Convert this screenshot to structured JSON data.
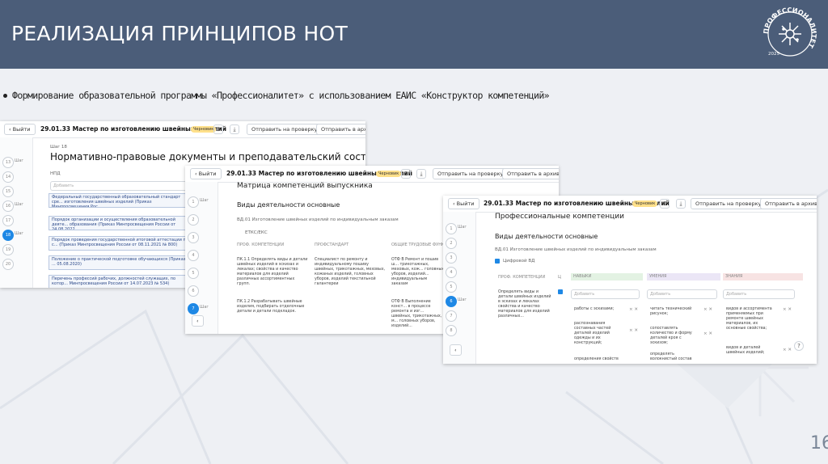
{
  "header": {
    "title": "РЕАЛИЗАЦИЯ ПРИНЦИПОВ НОТ",
    "logo_text": "ПРОФЕССИОНАЛИТЕТ",
    "logo_year": "2025"
  },
  "bullet": "Формирование образовательной программы «Профессионалитет» с использованием ЕАИС «Конструктор компетенций»",
  "page_number": "16",
  "app": {
    "back": "Выйти",
    "title": "29.01.33 Мастер по изготовлению швейных изделий",
    "status": "Черновик",
    "send_review": "Отправить на проверку",
    "send_archive": "Отправить в архив",
    "step_label": "Шаг",
    "steps": [
      "13",
      "14",
      "15",
      "16",
      "17",
      "18",
      "19",
      "20"
    ],
    "steps_b": [
      "1",
      "2",
      "3",
      "4",
      "5",
      "6",
      "7"
    ],
    "steps_c": [
      "1",
      "2",
      "3",
      "4",
      "5",
      "6",
      "7",
      "8"
    ]
  },
  "s1": {
    "step": "Шаг 18",
    "heading": "Нормативно-правовые документы и преподавательский состав",
    "npd": "НПД",
    "add": "Добавить",
    "docs": [
      "Федеральный государственный образовательный стандарт сре... изготовления швейных изделий (Приказ Минпросвещения Рос...",
      "Порядок организации и осуществления образовательной деяте... образования (Приказ Минпросвещения России от 24.08.2022",
      "Порядок проведения государственной итоговой аттестации по с... (Приказ Минпросвещения России от 08.11.2021 № 800)",
      "Положение о практической подготовке обучающихся (Приказ ... 05.08.2020)",
      "Перечень профессий рабочих, должностей служащих, по котор... Минпросвещения России от 14.07.2023 № 534)"
    ]
  },
  "s2": {
    "heading": "Матрица компетенций выпускника",
    "sub": "Виды деятельности основные",
    "vd": "ВД.01 Изготовление швейных изделий по индивидуальным заказам",
    "etks": "ЕТКС/ЕКС",
    "cols": [
      "ПРОФ. КОМПЕТЕНЦИИ",
      "ПРОФСТАНДАРТ",
      "ОБЩИЕ ТРУДОВЫЕ ФУНК..."
    ],
    "r1": [
      "ПК.1.1 Определять виды и детали швейных изделий в эскизах и лекалах; свойства и качество материалов для изделий различных ассортиментных групп.",
      "Специалист по ремонту и индивидуальному пошиву швейных, трикотажных, меховых, кожаных изделий, головных уборов, изделий текстильной галантереи",
      "ОТФ В Ремонт и пошив ш... трикотажных, меховых, кож... головных уборов, изделий... индивидуальным заказам"
    ],
    "r2": [
      "ПК.1.2 Разрабатывать швейные изделия, подбирать отделочные детали и детали подкладок.",
      "",
      "ОТФ В Выполнение конст... в процессе ремонта и изг... швейных, трикотажных, м... головных уборов, изделий..."
    ]
  },
  "s3": {
    "heading": "Профессиональные компетенции",
    "sub": "Виды деятельности основные",
    "vd": "ВД.01 Изготовление швейных изделий по индивидуальным заказам",
    "digital": "Цифровой ВД",
    "cols": [
      "ПРОФ. КОМПЕТЕНЦИИ",
      "Ц",
      "НАВЫКИ",
      "УМЕНИЯ",
      "ЗНАНИЯ"
    ],
    "pk": "Определять виды и детали швейных изделий в эскизах и лекалах свойства и качество материалов для изделий различных...",
    "skills": [
      "работы с эскизами;",
      "распознавания составных частей деталей изделий одежды и их конструкций;",
      "определения свойств"
    ],
    "abilities": [
      "читать технический рисунок;",
      "сопоставлять количество и форму деталей кроя с эскизом;",
      "определять волокнистый состав"
    ],
    "knowledge": [
      "видов и ассортимента применяемых при ремонте швейных материалов, их основные свойства;",
      "видов и деталей швейных изделий;"
    ]
  }
}
